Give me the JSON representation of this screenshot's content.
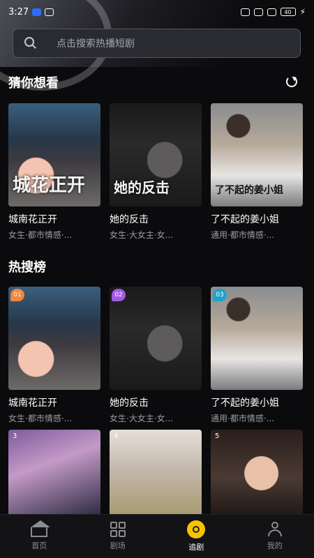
{
  "status": {
    "time": "3:27",
    "battery": "40"
  },
  "search": {
    "placeholder": "点击搜索热播短剧"
  },
  "recommend": {
    "title": "猜你想看",
    "items": [
      {
        "title": "城南花正开",
        "tags": "女生·都市情感·...",
        "poster_text": "城花正开"
      },
      {
        "title": "她的反击",
        "tags": "女生·大女主·女...",
        "poster_text": "她的反击"
      },
      {
        "title": "了不起的姜小姐",
        "tags": "通用·都市情感·...",
        "poster_text": "了不起的姜小姐"
      }
    ]
  },
  "hot": {
    "title": "热搜榜",
    "items": [
      {
        "rank": "01",
        "title": "城南花正开",
        "tags": "女生·都市情感·...",
        "badge_color": "#f0863a"
      },
      {
        "rank": "02",
        "title": "她的反击",
        "tags": "女生·大女主·女...",
        "badge_color": "#a05ae0"
      },
      {
        "rank": "03",
        "title": "了不起的姜小姐",
        "tags": "通用·都市情感·...",
        "badge_color": "#1ea3c8"
      }
    ],
    "more": [
      {
        "rank": "3"
      },
      {
        "rank": "4"
      },
      {
        "rank": "5"
      }
    ]
  },
  "nav": {
    "items": [
      {
        "label": "首页",
        "icon": "home-icon"
      },
      {
        "label": "剧场",
        "icon": "theater-icon"
      },
      {
        "label": "追剧",
        "icon": "follow-icon"
      },
      {
        "label": "我的",
        "icon": "profile-icon"
      }
    ],
    "active": "追剧"
  }
}
